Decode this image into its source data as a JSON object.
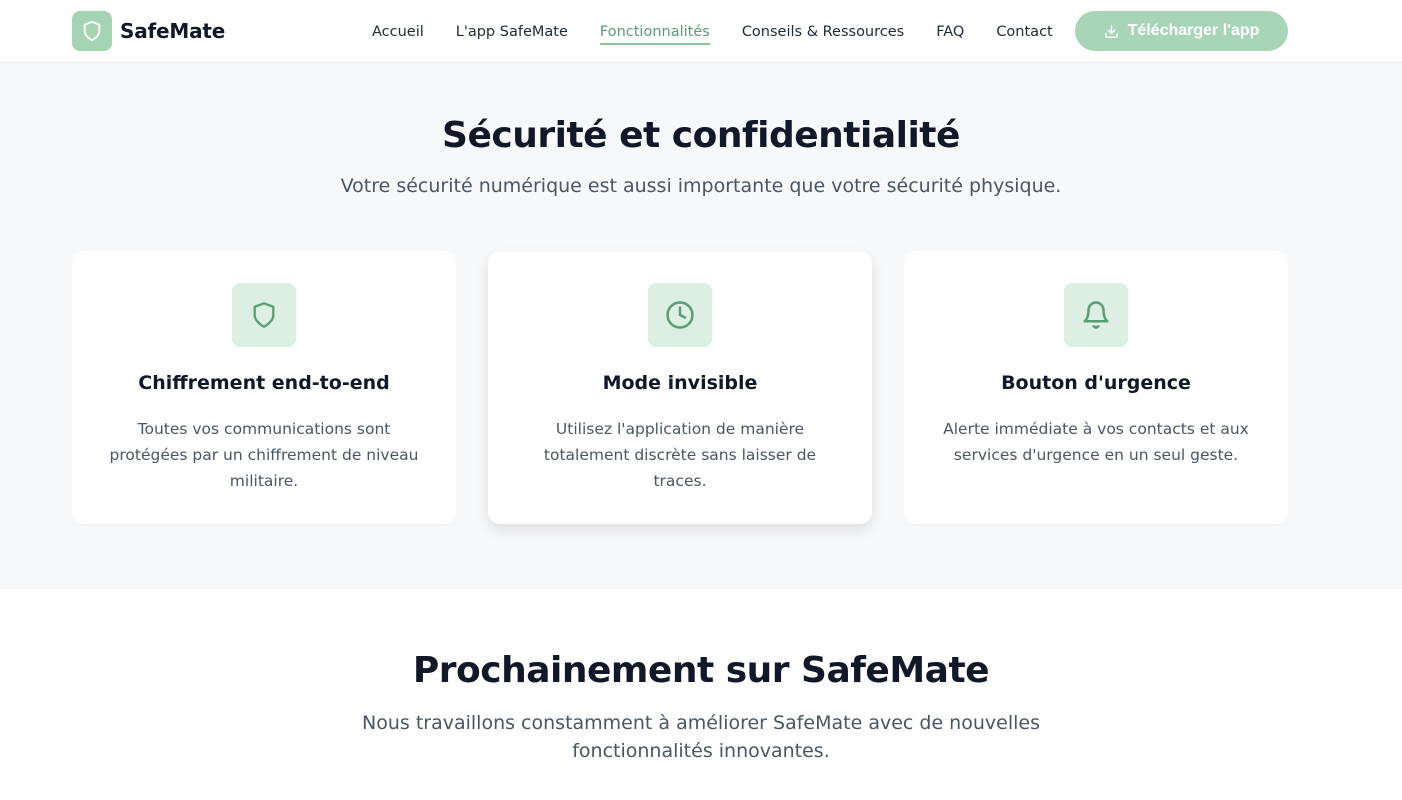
{
  "header": {
    "brand": "SafeMate",
    "nav": [
      {
        "label": "Accueil"
      },
      {
        "label": "L'app SafeMate"
      },
      {
        "label": "Fonctionnalités",
        "active": true
      },
      {
        "label": "Conseils & Ressources"
      },
      {
        "label": "FAQ"
      },
      {
        "label": "Contact"
      }
    ],
    "download_label": "Télécharger l'app"
  },
  "security": {
    "title": "Sécurité et confidentialité",
    "subtitle": "Votre sécurité numérique est aussi importante que votre sécurité physique.",
    "cards": [
      {
        "icon": "shield-icon",
        "title": "Chiffrement end-to-end",
        "text": "Toutes vos communications sont protégées par un chiffrement de niveau militaire."
      },
      {
        "icon": "clock-icon",
        "title": "Mode invisible",
        "text": "Utilisez l'application de manière totalement discrète sans laisser de traces."
      },
      {
        "icon": "bell-icon",
        "title": "Bouton d'urgence",
        "text": "Alerte immédiate à vos contacts et aux services d'urgence en un seul geste."
      }
    ]
  },
  "upcoming": {
    "title": "Prochainement sur SafeMate",
    "subtitle": "Nous travaillons constamment à améliorer SafeMate avec de nouvelles fonctionnalités innovantes."
  },
  "colors": {
    "accent": "#5a9d73",
    "accent_light": "#a8d5b8",
    "icon_bg": "#dcefe2",
    "section_bg": "#f7f8fa"
  }
}
